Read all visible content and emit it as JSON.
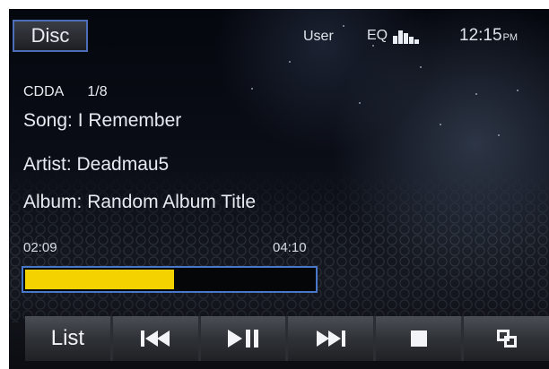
{
  "source": {
    "label": "Disc"
  },
  "status": {
    "user_label": "User",
    "eq_label": "EQ",
    "clock_time": "12:15",
    "clock_ampm": "PM"
  },
  "track": {
    "format": "CDDA",
    "track_counter": "1/8",
    "song": "Song: I Remember",
    "artist": "Artist: Deadmau5",
    "album": "Album: Random Album Title"
  },
  "playback": {
    "elapsed": "02:09",
    "total": "04:10",
    "progress_fraction": 0.52
  },
  "controls": {
    "list_label": "List",
    "prev_icon": "skip-previous-icon",
    "play_pause_icon": "play-pause-icon",
    "next_icon": "skip-next-icon",
    "stop_icon": "stop-icon",
    "last_icon": "copy-windows-icon"
  },
  "colors": {
    "progress_fill": "#f4d200",
    "accent_border": "#4a78c8"
  }
}
